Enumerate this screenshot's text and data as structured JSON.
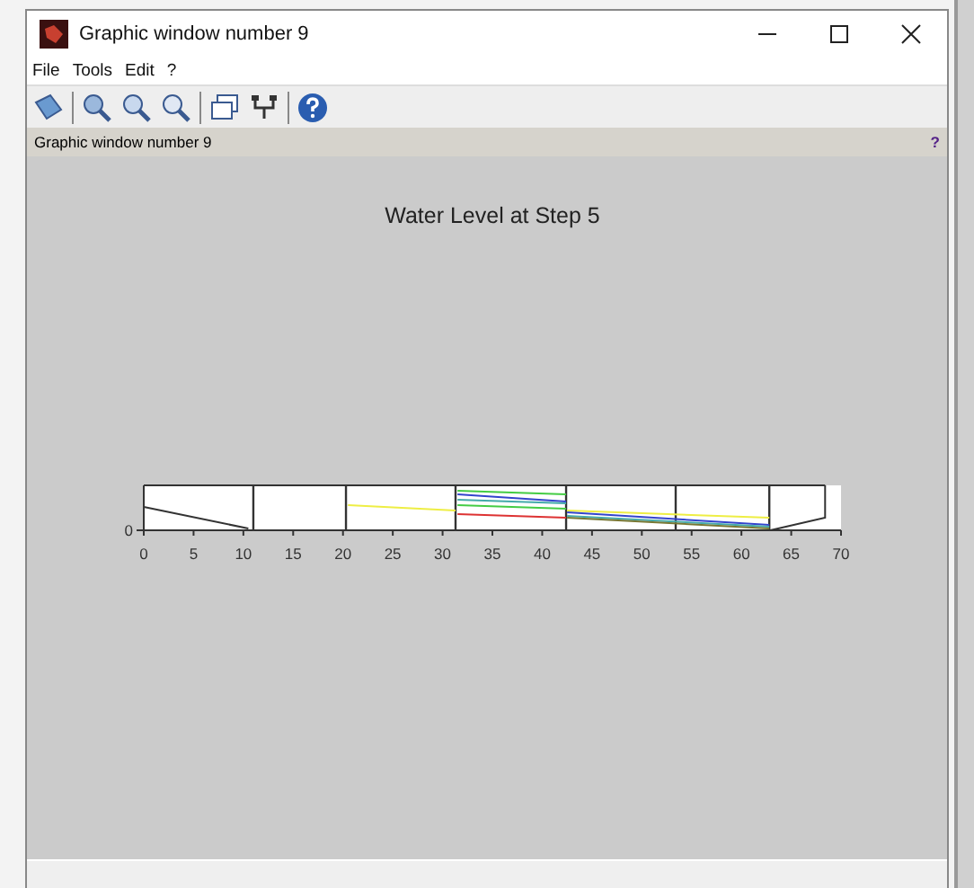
{
  "window": {
    "title": "Graphic window number 9"
  },
  "menu": [
    "File",
    "Tools",
    "Edit",
    "?"
  ],
  "info_bar": {
    "text": "Graphic window number 9",
    "help": "?"
  },
  "plot": {
    "title": "Water Level at Step 5",
    "xticks": [
      "0",
      "5",
      "10",
      "15",
      "20",
      "25",
      "30",
      "35",
      "40",
      "45",
      "50",
      "55",
      "60",
      "65",
      "70"
    ],
    "yticks": [
      "0"
    ]
  }
}
